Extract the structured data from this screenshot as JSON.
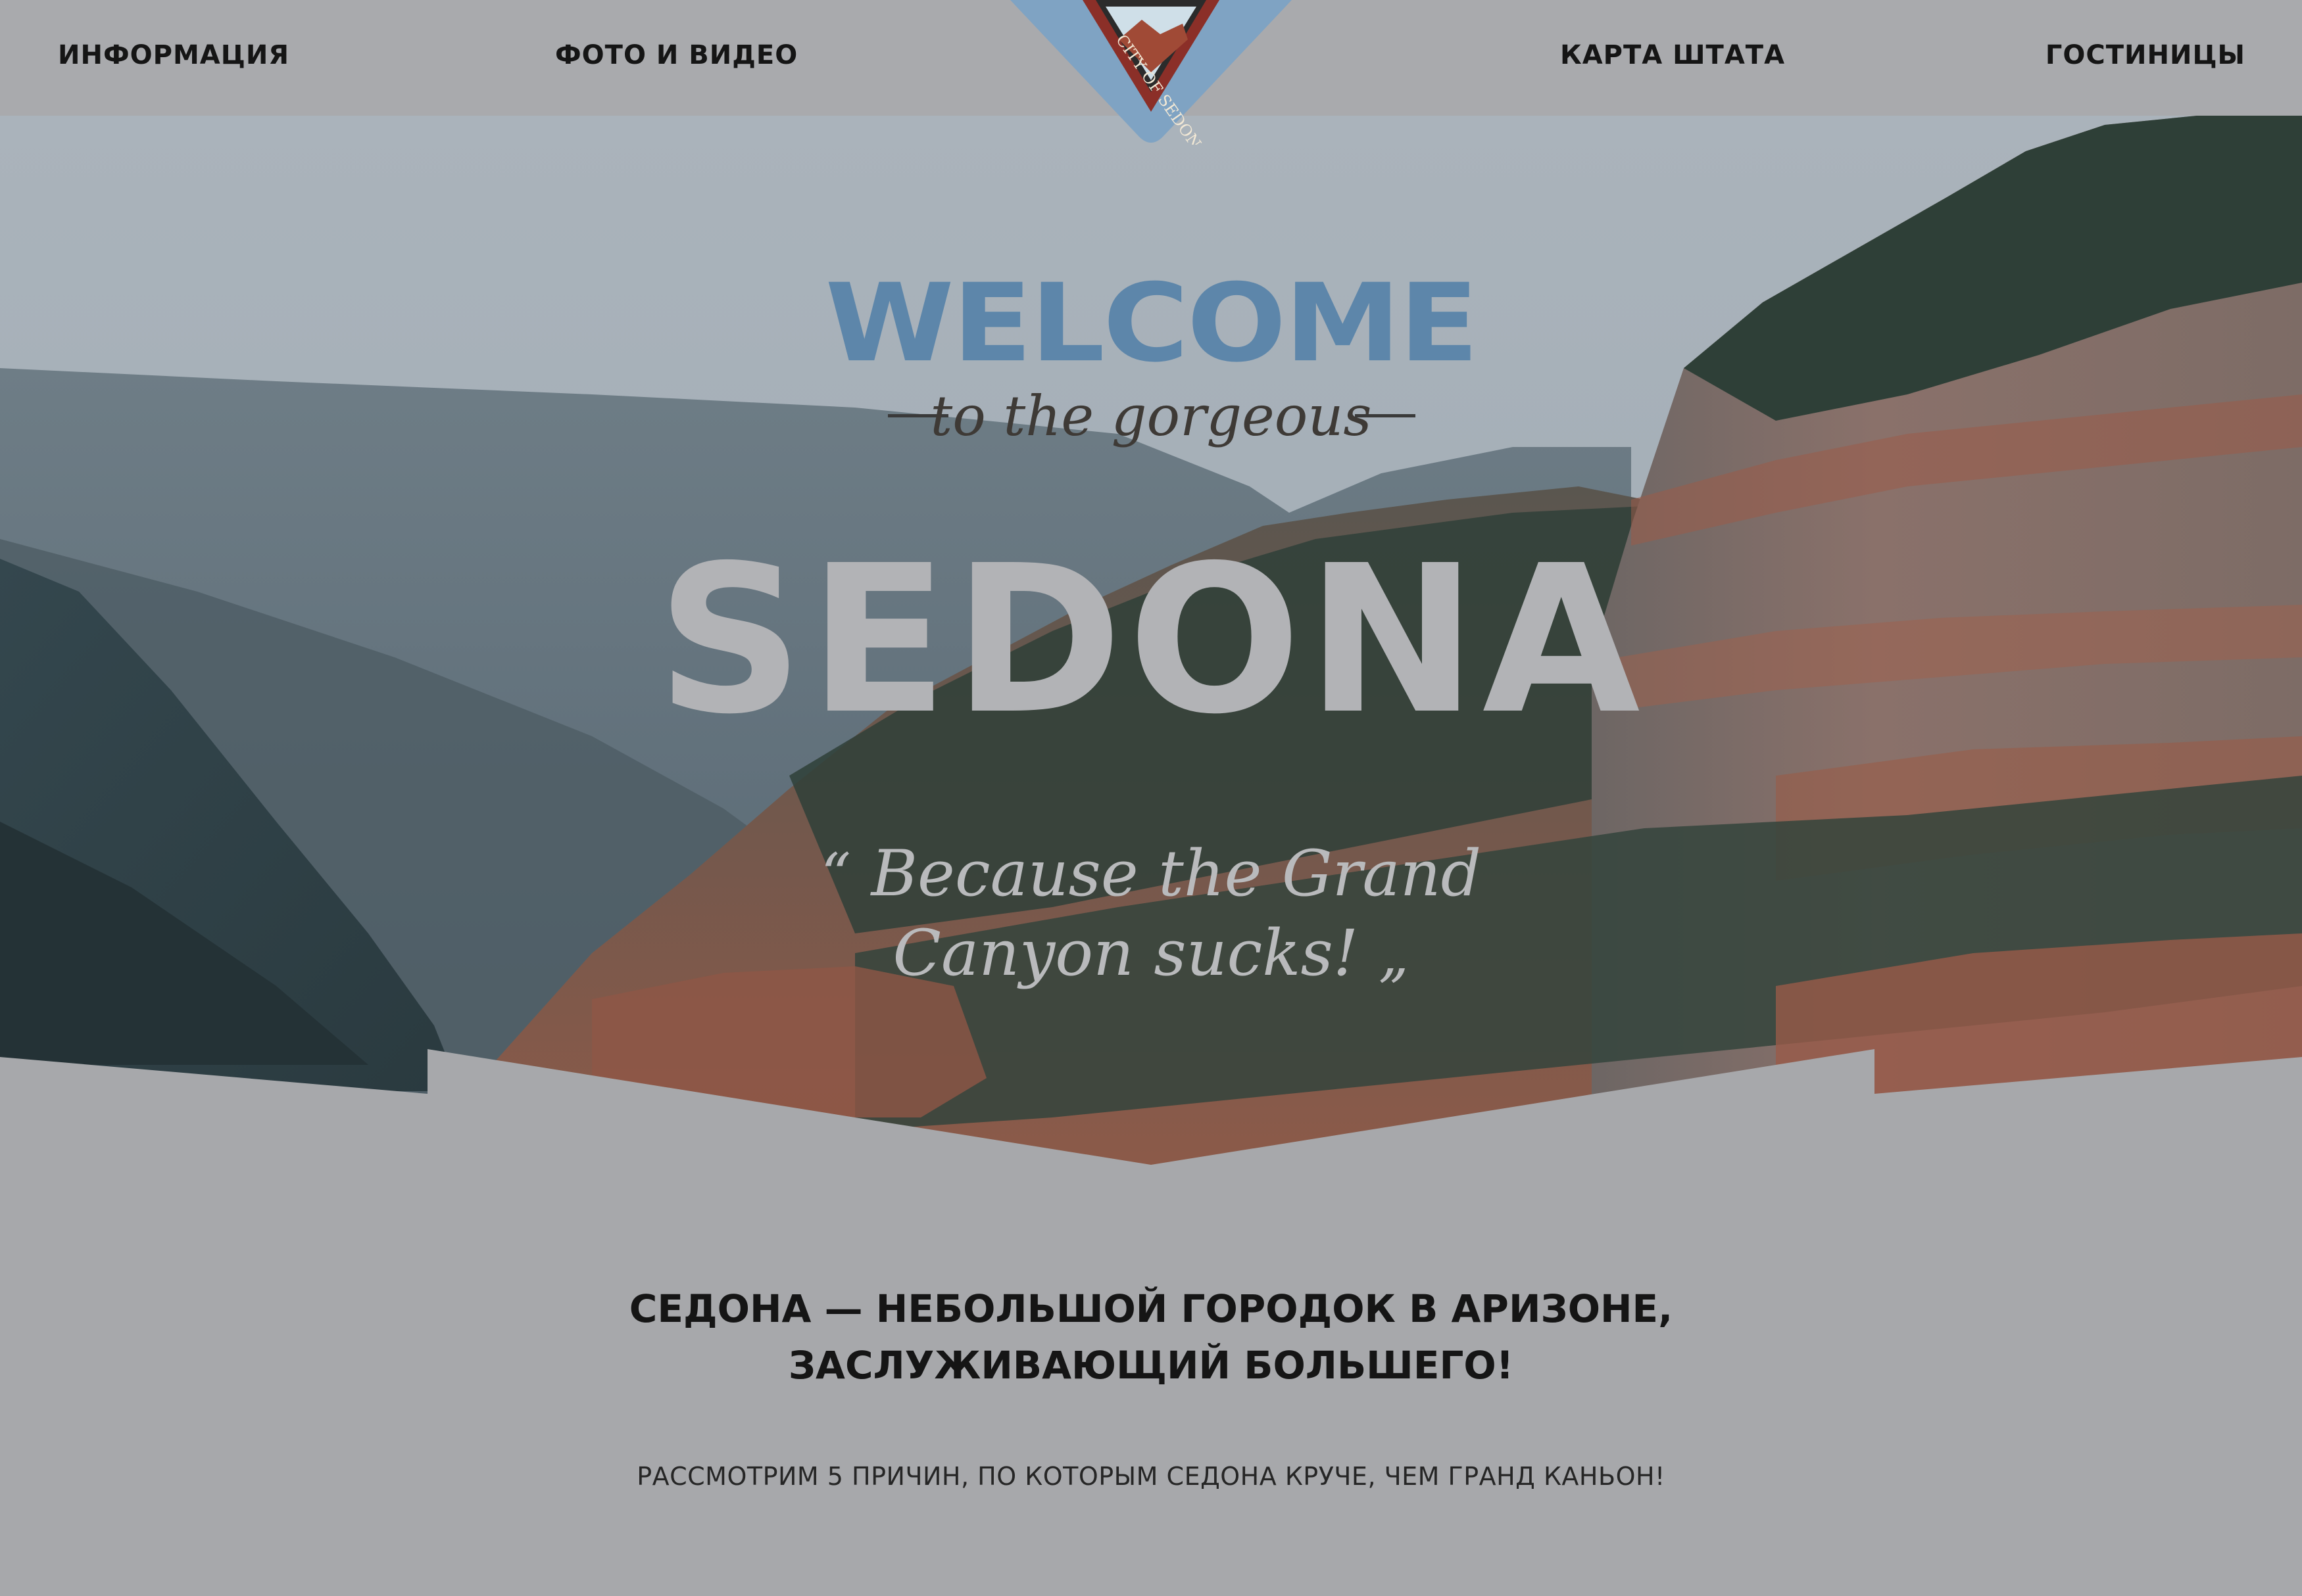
{
  "nav": {
    "items": [
      {
        "label": "ИНФОРМАЦИЯ"
      },
      {
        "label": "ФОТО И ВИДЕО"
      },
      {
        "label": "КАРТА ШТАТА"
      },
      {
        "label": "ГОСТИНИЦЫ"
      }
    ]
  },
  "logo": {
    "text": "CITY OF SEDONA"
  },
  "hero": {
    "welcome": "WELCOME",
    "subtitle": "to the gorgeous",
    "city": "SEDONA",
    "quote_open": "“",
    "quote_line1": "Because the Grand",
    "quote_line2": "Canyon sucks!",
    "quote_close": "„"
  },
  "content": {
    "headline_line1": "СЕДОНА — НЕБОЛЬШОЙ ГОРОДОК В АРИЗОНЕ,",
    "headline_line2": "ЗАСЛУЖИВАЮЩИЙ БОЛЬШЕГО!",
    "subline": "РАССМОТРИМ 5 ПРИЧИН, ПО КОТОРЫМ СЕДОНА КРУЧЕ, ЧЕМ ГРАНД КАНЬОН!"
  },
  "colors": {
    "background": "#a7a8ab",
    "welcome": "#5d86aa",
    "logo_blue": "#7fa3c3",
    "rock": "#9a5b48",
    "forest": "#2c3e35"
  }
}
